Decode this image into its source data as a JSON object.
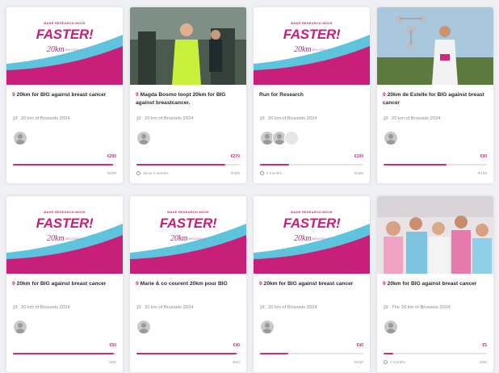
{
  "banner": {
    "subtitle": "MAKE RESEARCH MOVE",
    "headline": "FASTER!",
    "logo": "20km",
    "logo_small": "BRUSSELS"
  },
  "colors": {
    "accent": "#d1287e",
    "banner_blue": "#5ec3dc",
    "banner_pink": "#c71f7a"
  },
  "cards": [
    {
      "image": "banner",
      "mark": "9",
      "title": "20km for BIG against breast cancer",
      "event": "20 km of Brussels 2024",
      "avatars": 1,
      "faint_avatars": 0,
      "amount": "€290",
      "progress": 0.97,
      "time_left": "",
      "goal": "/€300"
    },
    {
      "image": "photo-runner-neon",
      "mark": "9",
      "title": "Magda Bosmo loopt 20km for BIG against breastcancer.",
      "event": "20 km of Brussels 2024",
      "avatars": 1,
      "faint_avatars": 0,
      "amount": "€270",
      "progress": 0.86,
      "time_left": "about 2 months",
      "goal": "/€300"
    },
    {
      "image": "banner",
      "mark": "",
      "title": "Run for Research",
      "event": "20 km of Brussels 2024",
      "avatars": 2,
      "faint_avatars": 1,
      "amount": "€100",
      "progress": 0.28,
      "time_left": "2 months",
      "goal": "/€360"
    },
    {
      "image": "photo-runner-atomium",
      "mark": "9",
      "title": "20km de Estelle for BIG against breast cancer",
      "event": "20 km of Brussels 2024",
      "avatars": 1,
      "faint_avatars": 0,
      "amount": "€90",
      "progress": 0.61,
      "time_left": "",
      "goal": "/€150"
    },
    {
      "image": "banner",
      "mark": "9",
      "title": "20km for BIG against breast cancer",
      "event": "20 km of Brussels 2024",
      "avatars": 1,
      "faint_avatars": 0,
      "amount": "€50",
      "progress": 0.98,
      "time_left": "",
      "goal": "/€50"
    },
    {
      "image": "banner",
      "mark": "9",
      "title": "Marie & co courent 20km pour BIG",
      "event": "20 km of Brussels 2024",
      "avatars": 1,
      "faint_avatars": 0,
      "amount": "€40",
      "progress": 0.97,
      "time_left": "",
      "goal": "/€40"
    },
    {
      "image": "banner",
      "mark": "9",
      "title": "20km for BIG against breast cancer",
      "event": "20 km of Brussels 2024",
      "avatars": 1,
      "faint_avatars": 0,
      "amount": "€40",
      "progress": 0.27,
      "time_left": "",
      "goal": "/€150"
    },
    {
      "image": "photo-team",
      "mark": "9",
      "title": "20km for BIG against breast cancer",
      "event": "The 20 km of Brussels 2024",
      "avatars": 1,
      "faint_avatars": 0,
      "amount": "€5",
      "progress": 0.09,
      "time_left": "2 months",
      "goal": "/€60"
    }
  ]
}
